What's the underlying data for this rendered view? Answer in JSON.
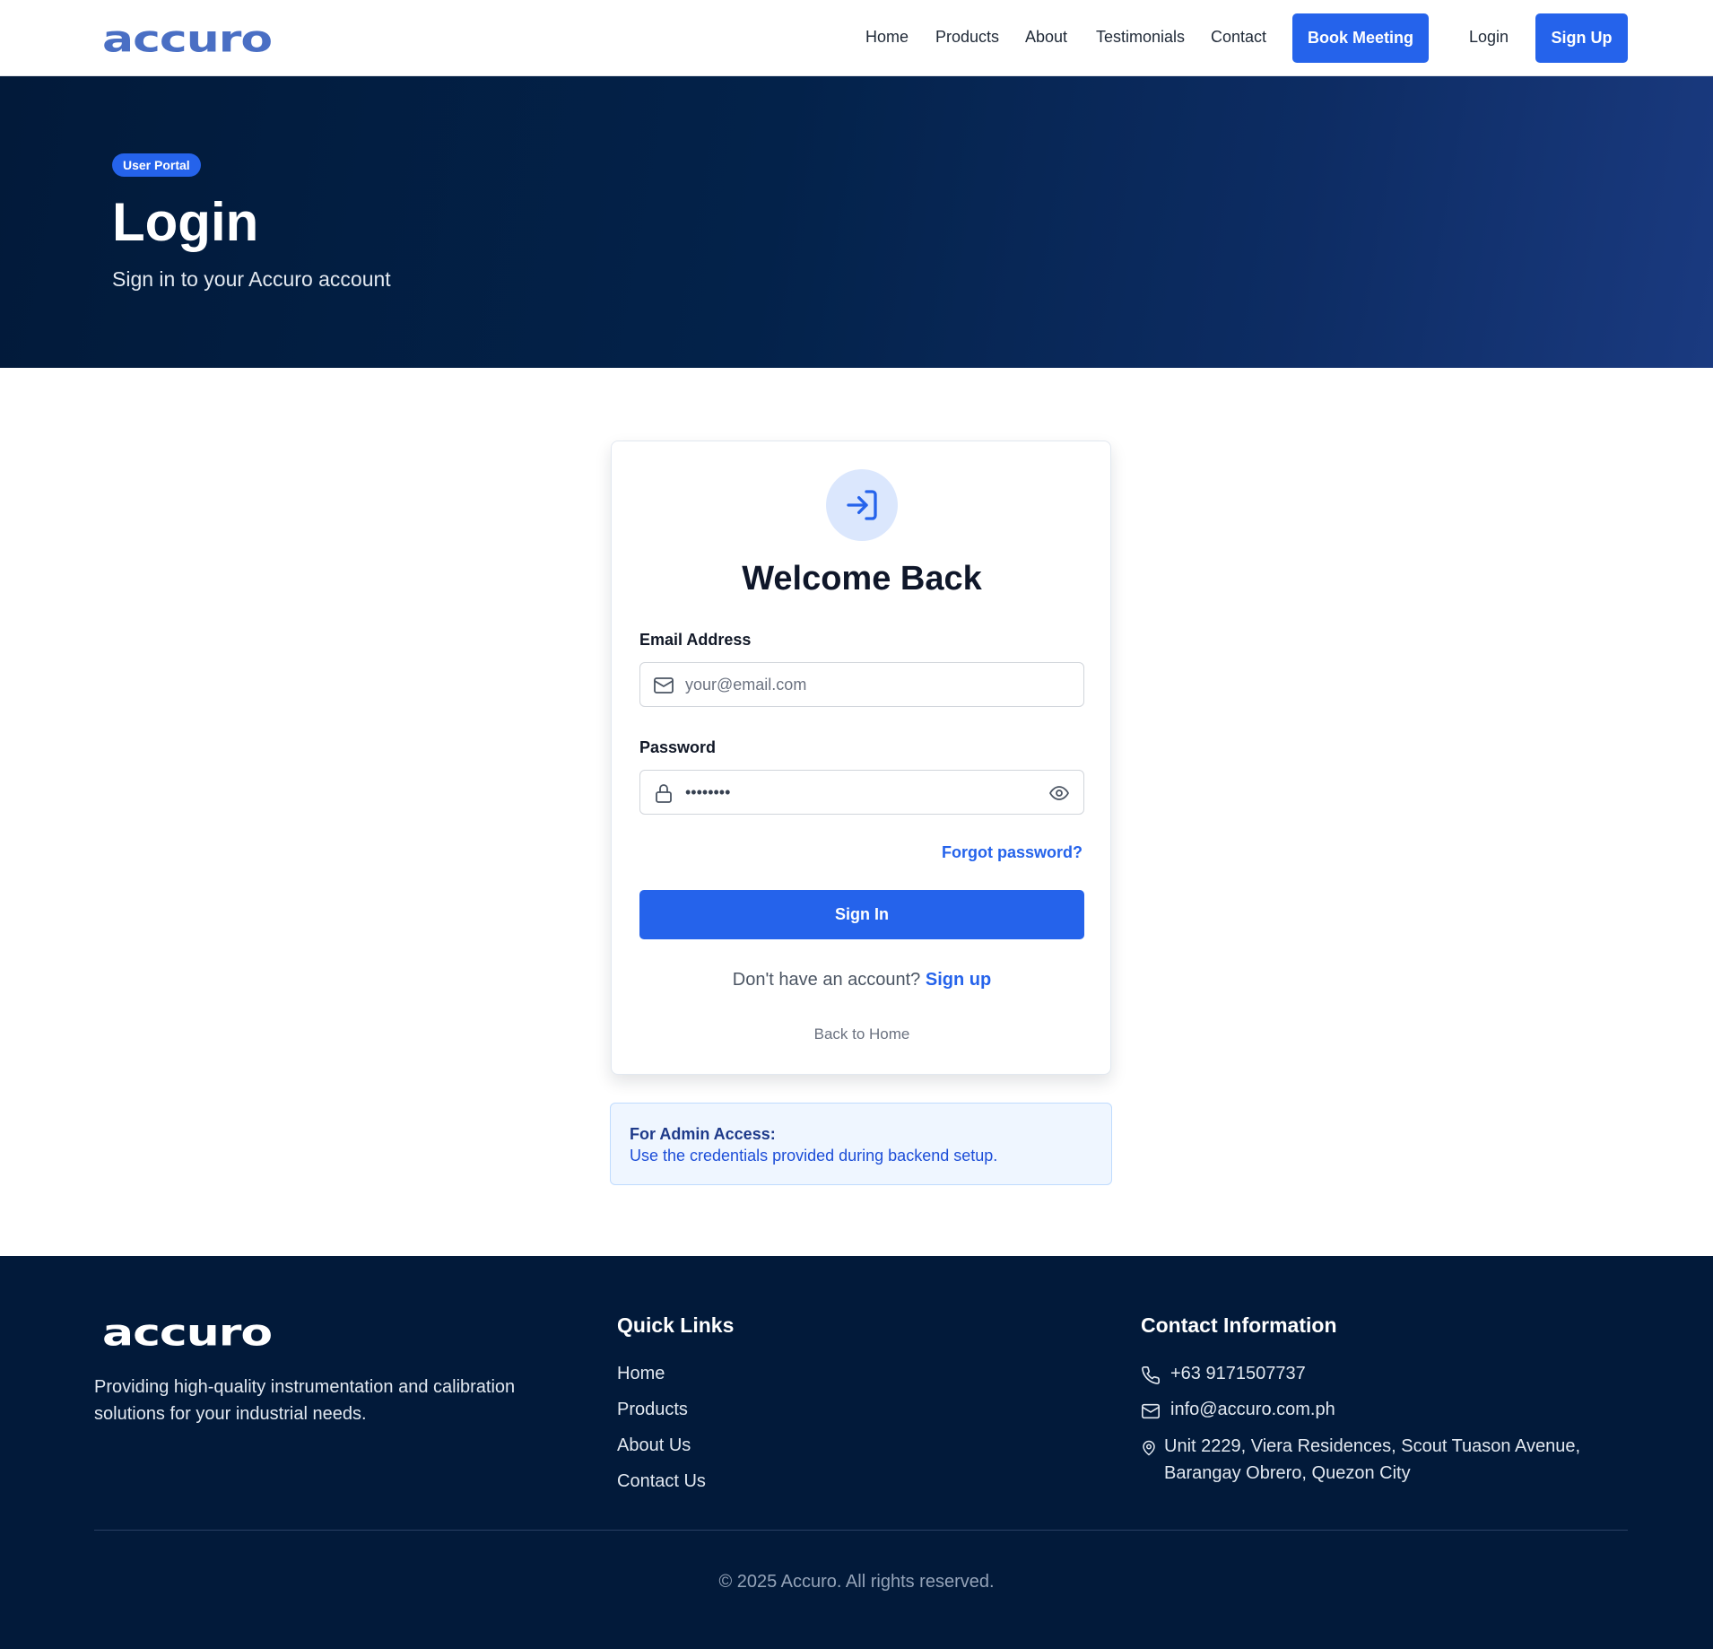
{
  "brand": {
    "logo": "accuro",
    "accent": "#2563eb",
    "navy": "#021a3a"
  },
  "nav": {
    "links": [
      "Home",
      "Products",
      "About",
      "Testimonials",
      "Contact"
    ],
    "book_meeting": "Book Meeting",
    "login": "Login",
    "sign_up": "Sign Up"
  },
  "hero": {
    "badge": "User Portal",
    "title": "Login",
    "subtitle": "Sign in to your Accuro account"
  },
  "card": {
    "icon": "log-in-icon",
    "title": "Welcome Back",
    "email": {
      "label": "Email Address",
      "placeholder": "your@email.com",
      "icon": "mail-icon"
    },
    "password": {
      "label": "Password",
      "value": "••••••••",
      "icon": "lock-icon",
      "toggle_icon": "eye-icon"
    },
    "forgot": "Forgot password?",
    "submit": "Sign In",
    "no_account": "Don't have an account?",
    "sign_up_link": "Sign up",
    "back_home": "Back to Home"
  },
  "admin_note": {
    "title": "For Admin Access:",
    "text": "Use the credentials provided during backend setup."
  },
  "footer": {
    "logo": "accuro",
    "tagline": "Providing high-quality instrumentation and calibration solutions for your industrial needs.",
    "quick_links_heading": "Quick Links",
    "quick_links": [
      "Home",
      "Products",
      "About Us",
      "Contact Us"
    ],
    "contact_heading": "Contact Information",
    "phone": "+63 9171507737",
    "email": "info@accuro.com.ph",
    "address": "Unit 2229, Viera Residences, Scout Tuason Avenue, Barangay Obrero, Quezon City",
    "copyright": "© 2025 Accuro. All rights reserved."
  }
}
